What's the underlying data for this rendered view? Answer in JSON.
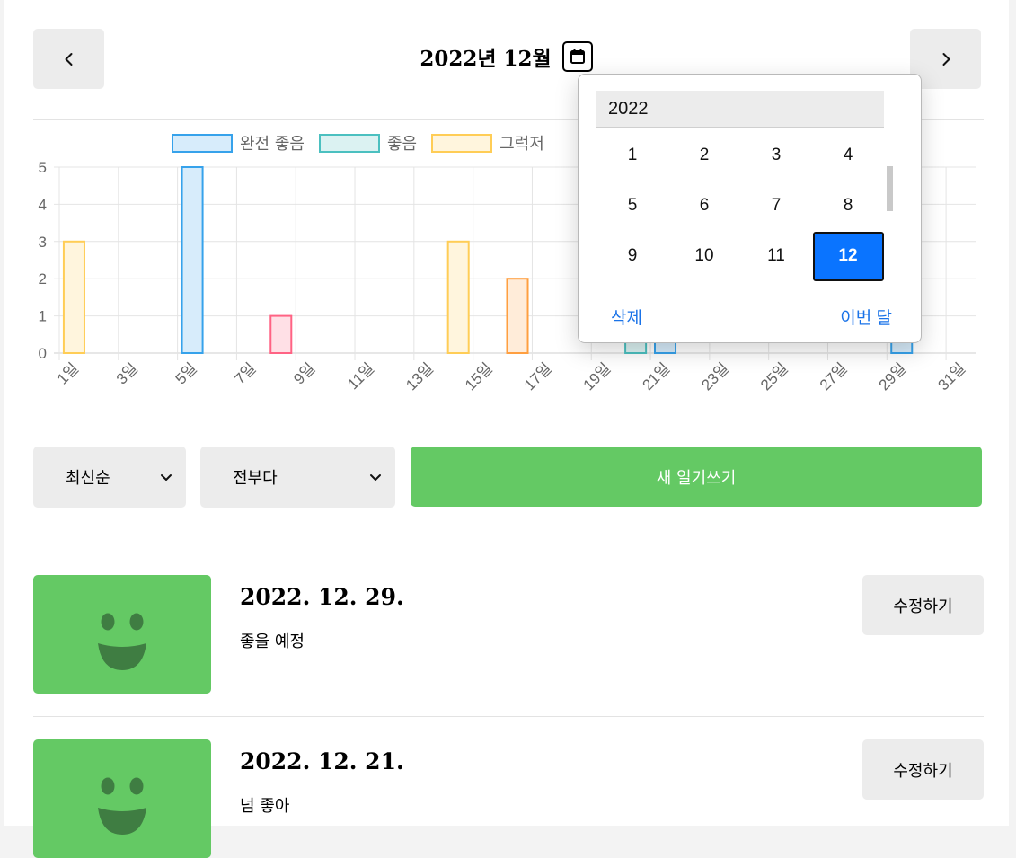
{
  "header": {
    "title": "2022년 12월",
    "prev_icon": "chevron-left-icon",
    "next_icon": "chevron-right-icon",
    "calendar_icon": "calendar-icon"
  },
  "chart_data": {
    "type": "bar",
    "legend_visible": [
      "완전 좋음",
      "좋음",
      "그럭저"
    ],
    "legend": [
      {
        "name": "완전 좋음",
        "color": "#36a2eb",
        "fill": "#d7ecfb"
      },
      {
        "name": "좋음",
        "color": "#4bc0c0",
        "fill": "#dbf2f2"
      },
      {
        "name": "그럭저럭",
        "color": "#ffcd56",
        "fill": "#fff5dd"
      }
    ],
    "ylim": [
      0,
      5
    ],
    "yticks": [
      "0",
      "1",
      "2",
      "3",
      "4",
      "5"
    ],
    "days": 31,
    "xtick_labels": [
      "1일",
      "3일",
      "5일",
      "7일",
      "9일",
      "11일",
      "13일",
      "15일",
      "17일",
      "19일",
      "21일",
      "23일",
      "25일",
      "27일",
      "29일",
      "31일"
    ],
    "bars": [
      {
        "day": 1,
        "value": 3,
        "color": "#ffcd56",
        "fill": "#fff5dd"
      },
      {
        "day": 5,
        "value": 5,
        "color": "#36a2eb",
        "fill": "#d7ecfb"
      },
      {
        "day": 8,
        "value": 1,
        "color": "#ff6384",
        "fill": "#ffe0e6"
      },
      {
        "day": 14,
        "value": 3,
        "color": "#ffcd56",
        "fill": "#fff5dd"
      },
      {
        "day": 16,
        "value": 2,
        "color": "#ff9f40",
        "fill": "#ffecd9"
      },
      {
        "day": 20,
        "value": 1,
        "color": "#4bc0c0",
        "fill": "#dbf2f2"
      },
      {
        "day": 21,
        "value": 1,
        "color": "#36a2eb",
        "fill": "#d7ecfb"
      },
      {
        "day": 29,
        "value": 1,
        "color": "#36a2eb",
        "fill": "#d7ecfb"
      }
    ]
  },
  "controls": {
    "sort_selected": "최신순",
    "filter_selected": "전부다",
    "new_button": "새 일기쓰기",
    "dropdown_icon": "chevron-down-icon"
  },
  "diaries": [
    {
      "date": "2022. 12. 29.",
      "content": "좋을 예정",
      "edit": "수정하기",
      "emotion_icon": "smile-face-icon"
    },
    {
      "date": "2022. 12. 21.",
      "content": "넘 좋아",
      "edit": "수정하기",
      "emotion_icon": "smile-face-icon"
    }
  ],
  "month_picker": {
    "year": "2022",
    "months": [
      "1",
      "2",
      "3",
      "4",
      "5",
      "6",
      "7",
      "8",
      "9",
      "10",
      "11",
      "12"
    ],
    "selected": "12",
    "delete_label": "삭제",
    "this_month_label": "이번 달"
  }
}
